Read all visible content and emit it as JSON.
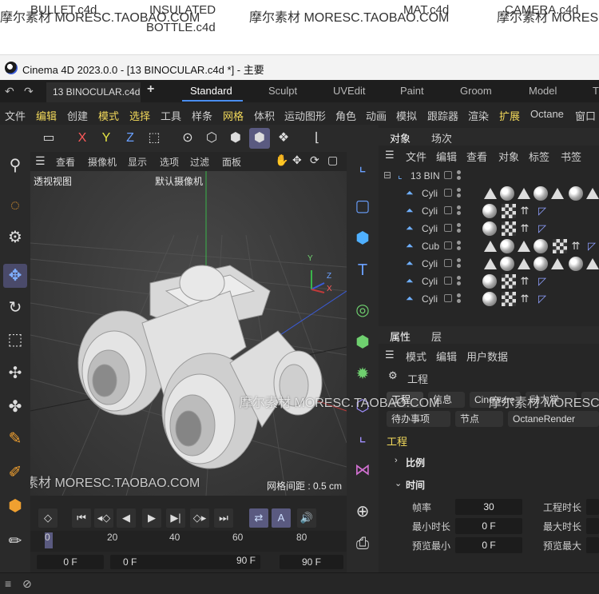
{
  "banner": {
    "items": [
      {
        "text": "BULLET.c4d"
      },
      {
        "text": "INSULATED"
      },
      {
        "text": "BOTTLE.c4d"
      },
      {
        "text": "MAT.c4d"
      },
      {
        "text": "CAMERA.c4d"
      }
    ],
    "watermark": "摩尔素材 MORESC.TAOBAO.COM"
  },
  "window": {
    "title": "Cinema 4D 2023.0.0 - [13 BINOCULAR.c4d *] - 主要"
  },
  "tabs": {
    "doc_tab": "13 BINOCULAR.c4d",
    "plus": "+",
    "layouts": [
      "Standard",
      "Sculpt",
      "UVEdit",
      "Paint",
      "Groom",
      "Model",
      "T"
    ]
  },
  "menu": {
    "items": [
      "文件",
      "编辑",
      "创建",
      "模式",
      "选择",
      "工具",
      "样条",
      "网格",
      "体积",
      "运动图形",
      "角色",
      "动画",
      "模拟",
      "跟踪器",
      "渲染",
      "扩展",
      "Octane",
      "窗口"
    ]
  },
  "axis": {
    "x": "X",
    "y": "Y",
    "z": "Z"
  },
  "viewport": {
    "menu": [
      "查看",
      "摄像机",
      "显示",
      "选项",
      "过滤",
      "面板"
    ],
    "view_label": "透视视图",
    "camera_label": "默认摄像机",
    "grid_spacing": "网格间距 : 0.5 cm"
  },
  "timeline": {
    "ticks": [
      "0",
      "20",
      "40",
      "60",
      "80"
    ],
    "frame_start": "0 F",
    "frame_current": "0 F",
    "frame_end_a": "90 F",
    "frame_end_b": "90 F"
  },
  "object_manager": {
    "tabs": [
      "对象",
      "场次"
    ],
    "menu": [
      "文件",
      "编辑",
      "查看",
      "对象",
      "标签",
      "书签"
    ],
    "root": "13 BIN",
    "rows": [
      {
        "name": "Cyli"
      },
      {
        "name": "Cyli"
      },
      {
        "name": "Cyli"
      },
      {
        "name": "Cub"
      },
      {
        "name": "Cyli"
      },
      {
        "name": "Cyli"
      },
      {
        "name": "Cyli"
      }
    ]
  },
  "attributes": {
    "tabs": [
      "属性",
      "层"
    ],
    "menu": [
      "模式",
      "编辑",
      "用户数据"
    ],
    "project_label": "工程",
    "pills_row1": [
      "工程",
      "信息",
      "Cineware",
      "动力学",
      ""
    ],
    "pills_row2": [
      "待办事项",
      "节点",
      "OctaneRender"
    ],
    "section": "工程",
    "sub_scale": "比例",
    "sub_time": "时间",
    "fields": {
      "fps_label": "帧率",
      "fps": "30",
      "project_length_label": "工程时长",
      "min_length_label": "最小时长",
      "min_length": "0 F",
      "max_length_label": "最大时长",
      "preview_min_label": "预览最小",
      "preview_min": "0 F",
      "preview_max_label": "预览最大"
    }
  }
}
